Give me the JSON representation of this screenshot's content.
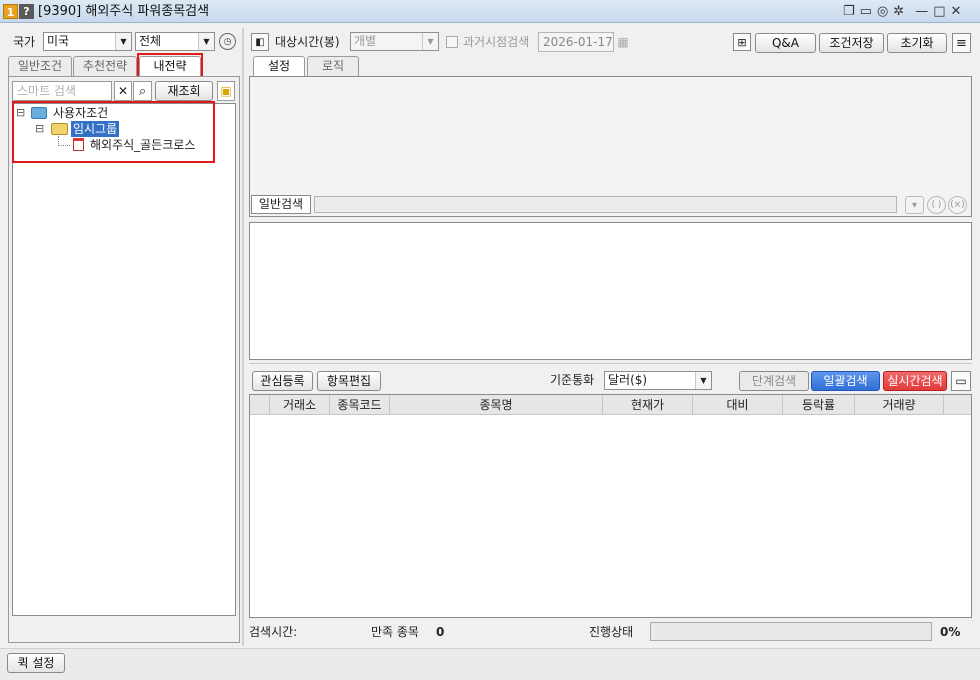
{
  "titlebar": {
    "badge1": "1",
    "badge2": "?",
    "title": "[9390] 해외주식 파워종목검색",
    "controls": [
      "❐",
      "▭",
      "◎",
      "✲",
      "—",
      "□",
      "✕"
    ]
  },
  "left": {
    "country_label": "국가",
    "country_value": "미국",
    "market_value": "전체",
    "tabs": [
      "일반조건",
      "추천전략",
      "내전략"
    ],
    "search_placeholder": "스마트 검색",
    "search_clear": "✕",
    "search_btn": "⌕",
    "reload_label": "재조회",
    "tree": {
      "root": "사용자조건",
      "group": "임시그룹",
      "item": "해외주식_골든크로스",
      "expander1": "⊟",
      "expander2": "⊟"
    }
  },
  "toolbar": {
    "target_time_label": "대상시간(봉)",
    "target_time_value": "개별",
    "past_search_label": "과거시점검색",
    "past_date": "2026-01-17",
    "qa_label": "Q&A",
    "save_cond_label": "조건저장",
    "reset_label": "초기화"
  },
  "cond_tabs": [
    "설정",
    "로직"
  ],
  "general_search_label": "일반검색",
  "formula_buttons": [
    "▾",
    "( )",
    "(×)"
  ],
  "result_toolbar": {
    "register_label": "관심등록",
    "edit_items_label": "항목편집",
    "currency_label": "기준통화",
    "currency_value": "달러($)",
    "step_search": "단계검색",
    "batch_search": "일괄검색",
    "realtime_search": "실시간검색",
    "export_icon": "▭"
  },
  "table": {
    "columns": [
      "",
      "거래소",
      "종목코드",
      "종목명",
      "현재가",
      "대비",
      "등락률",
      "거래량"
    ]
  },
  "status": {
    "search_time_label": "검색시간:",
    "match_label": "만족 종목",
    "match_count": "0",
    "progress_label": "진행상태",
    "progress_pct": "0%",
    "progress_value": 0
  },
  "footer": {
    "quick_settings": "퀵 설정"
  },
  "colors": {
    "accent_blue": "#2f6fd6",
    "realtime_red": "#e23a3a",
    "highlight": "#e2181c",
    "selection": "#3370c6"
  }
}
